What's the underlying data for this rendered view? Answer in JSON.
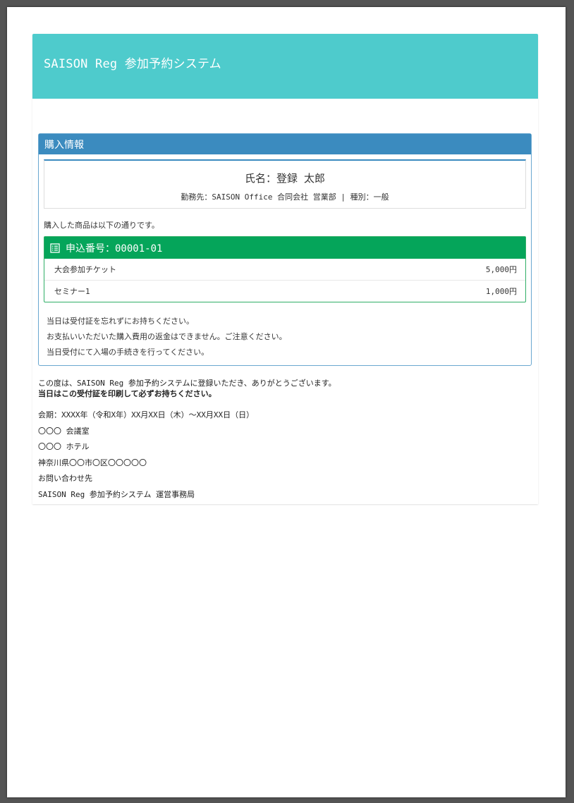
{
  "header": {
    "title": "SAISON Reg 参加予約システム"
  },
  "panel": {
    "title": "購入情報",
    "person": {
      "name": "氏名：登録 太郎",
      "meta": "勤務先：SAISON Office 合同会社 営業部 | 種別：一般"
    },
    "intro": "購入した商品は以下の通りです。",
    "order": {
      "title": "申込番号：00001-01",
      "icon": "list-icon",
      "items": [
        {
          "name": "大会参加チケット",
          "price": "5,000円"
        },
        {
          "name": "セミナー1",
          "price": "1,000円"
        }
      ]
    },
    "notes": [
      "当日は受付証を忘れずにお持ちください。",
      "お支払いいただいた購入費用の返金はできません。ご注意ください。",
      "当日受付にて入場の手続きを行ってください。"
    ]
  },
  "thanks": {
    "line1": "この度は、SAISON Reg 参加予約システムに登録いただき、ありがとうございます。",
    "line2": "当日はこの受付証を印刷して必ずお持ちください。"
  },
  "info": [
    "会期：XXXX年（令和X年）XX月XX日（木）〜XX月XX日（日）",
    "〇〇〇 会議室",
    "〇〇〇 ホテル",
    "神奈川県〇〇市〇区〇〇〇〇〇",
    "お問い合わせ先",
    "SAISON Reg 参加予約システム 運営事務局"
  ],
  "colors": {
    "header": "#4ecbcc",
    "panel_head": "#3b8bbf",
    "order_head": "#05a55a"
  }
}
